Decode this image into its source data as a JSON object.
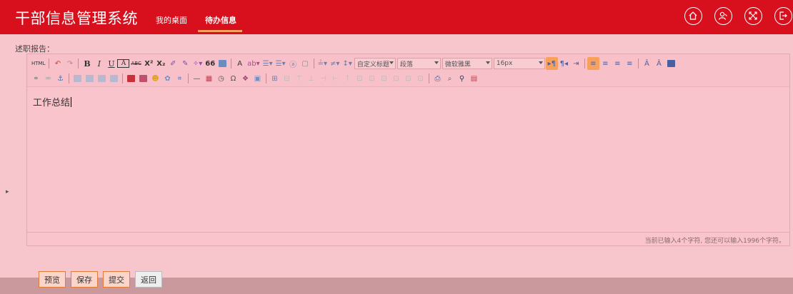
{
  "header": {
    "app_title": "干部信息管理系统",
    "nav": [
      {
        "label": "我的桌面",
        "active": false
      },
      {
        "label": "待办信息",
        "active": true
      }
    ],
    "icons": [
      "home-icon",
      "user-switch-icon",
      "fullscreen-icon",
      "logout-icon"
    ],
    "brand_color": "#d80f1c",
    "accent_color": "#f7a15c"
  },
  "form": {
    "section_label": "述职报告：",
    "toolbar": {
      "row1": {
        "html_label": "HTML",
        "bold": "B",
        "italic": "I",
        "underline": "U",
        "border": "A",
        "strike": "ABC",
        "superscript": "X²",
        "subscript": "X₂",
        "quote": "66",
        "font_color": "A",
        "title_select": "自定义标题",
        "paragraph_select": "段落",
        "font_select": "微软雅黑",
        "size_select": "16px"
      },
      "row2": {}
    },
    "content": "工作总结",
    "status": "当前已输入4个字符, 您还可以输入1996个字符。"
  },
  "actions": {
    "preview": "预览",
    "save": "保存",
    "submit": "提交",
    "back": "返回"
  },
  "sidebar_toggle": "▸"
}
